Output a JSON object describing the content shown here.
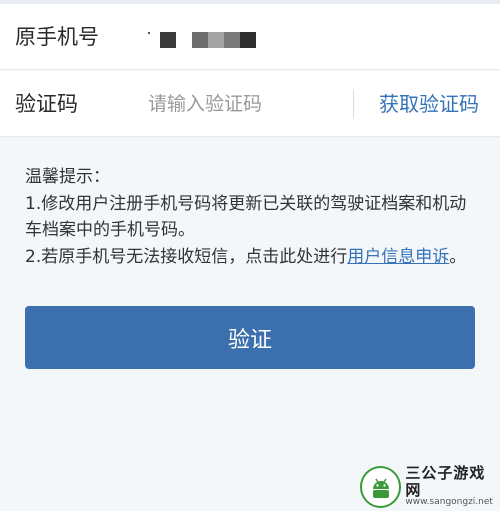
{
  "form": {
    "phone_label": "原手机号",
    "code_label": "验证码",
    "code_placeholder": "请输入验证码",
    "get_code_label": "获取验证码"
  },
  "tips": {
    "title": "温馨提示：",
    "line1": "1.修改用户注册手机号码将更新已关联的驾驶证档案和机动车档案中的手机号码。",
    "line2_prefix": "2.若原手机号无法接收短信，点击此处进行",
    "line2_link": "用户信息申诉",
    "line2_suffix": "。"
  },
  "verify_button_label": "验证",
  "watermark": {
    "title": "三公子游戏网",
    "url": "www.sangongzi.net"
  },
  "colors": {
    "accent": "#3572b8",
    "button": "#3b6fae",
    "background": "#f4f7fa"
  }
}
